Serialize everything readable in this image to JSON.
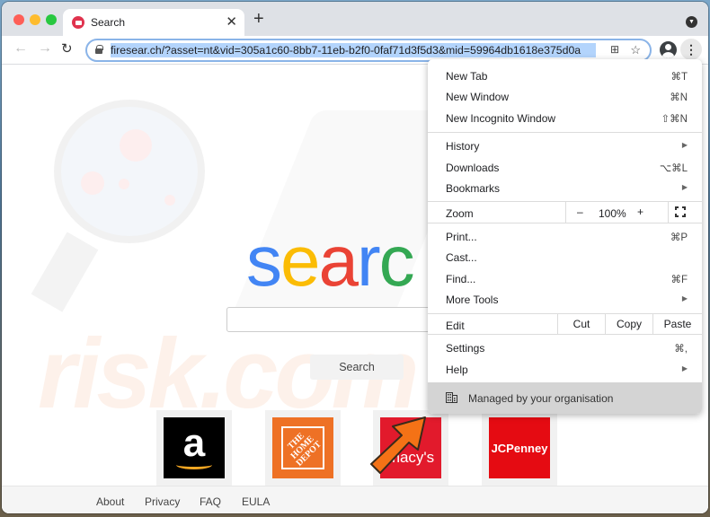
{
  "browser": {
    "tab_title": "Search",
    "tab_close": "✕",
    "new_tab": "+",
    "url": "firesear.ch/?asset=nt&vid=305a1c60-8bb7-11eb-b2f0-0faf71d3f5d3&mid=59964db1618e375d0a",
    "nav": {
      "back": "←",
      "forward": "→",
      "reload": "↻"
    },
    "icons": {
      "qr": "⊞",
      "star": "☆",
      "menu": "⋮",
      "tab_search": "▼"
    }
  },
  "page": {
    "logo_letters": [
      {
        "char": "s",
        "color": "#4285f4"
      },
      {
        "char": "e",
        "color": "#fbbc05"
      },
      {
        "char": "a",
        "color": "#ea4335"
      },
      {
        "char": "r",
        "color": "#4285f4"
      },
      {
        "char": "c",
        "color": "#34a853"
      }
    ],
    "search_input_placeholder": "",
    "search_button": "Search",
    "shortcuts": [
      {
        "name": "Amazon",
        "text": "a",
        "color": "#000000"
      },
      {
        "name": "The Home Depot",
        "text": "THE HOME DEPOT",
        "color": "#ee7125"
      },
      {
        "name": "Macy's",
        "text": "macy's",
        "color": "#e21a2c"
      },
      {
        "name": "JCPenney",
        "text": "JCPenney",
        "color": "#e50b12"
      }
    ],
    "footer_links": [
      "About",
      "Privacy",
      "FAQ",
      "EULA"
    ],
    "watermark": "risk.com"
  },
  "menu": {
    "group1": [
      {
        "label": "New Tab",
        "shortcut": "⌘T"
      },
      {
        "label": "New Window",
        "shortcut": "⌘N"
      },
      {
        "label": "New Incognito Window",
        "shortcut": "⇧⌘N"
      }
    ],
    "group2": [
      {
        "label": "History",
        "submenu": "▶"
      },
      {
        "label": "Downloads",
        "shortcut": "⌥⌘L"
      },
      {
        "label": "Bookmarks",
        "submenu": "▶"
      }
    ],
    "zoom": {
      "label": "Zoom",
      "minus": "–",
      "value": "100%",
      "plus": "+"
    },
    "group3": [
      {
        "label": "Print...",
        "shortcut": "⌘P"
      },
      {
        "label": "Cast..."
      },
      {
        "label": "Find...",
        "shortcut": "⌘F"
      },
      {
        "label": "More Tools",
        "submenu": "▶"
      }
    ],
    "edit": {
      "label": "Edit",
      "cut": "Cut",
      "copy": "Copy",
      "paste": "Paste"
    },
    "group4": [
      {
        "label": "Settings",
        "shortcut": "⌘,"
      },
      {
        "label": "Help",
        "submenu": "▶"
      }
    ],
    "managed": "Managed by your organisation"
  }
}
